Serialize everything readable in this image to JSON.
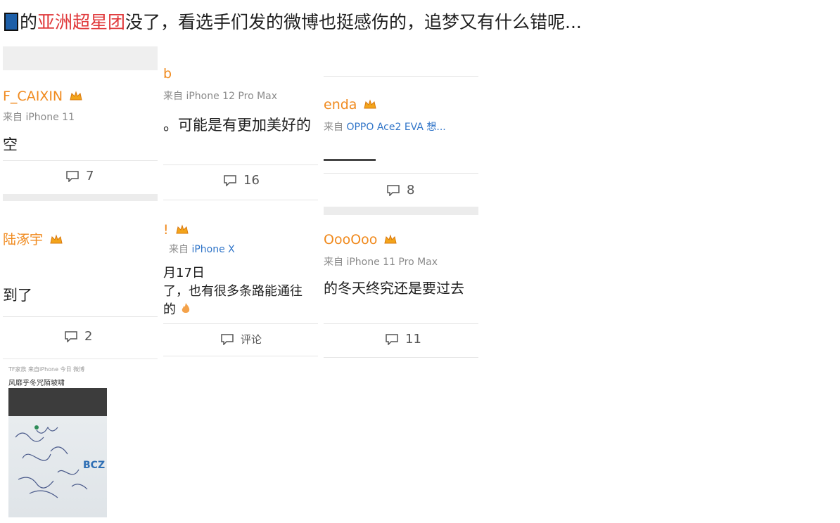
{
  "headline": {
    "mark": "",
    "part1": "的",
    "highlight": "亚洲超星团",
    "part2": "没了，看选手们发的微博也挺感伤的，追梦又有什么错呢..."
  },
  "cards": [
    {
      "user": "F_CAIXIN",
      "source_prefix": "来自 ",
      "source": "iPhone 11",
      "text": "空",
      "comments": "7"
    },
    {
      "user": "b",
      "source_prefix": "来自 ",
      "source": "iPhone 12 Pro Max",
      "text": "。可能是有更加美好的",
      "comments": "16"
    },
    {
      "user": "enda",
      "source_prefix": "来自 ",
      "source": "OPPO Ace2 EVA 想...",
      "text": "",
      "comments": "8"
    },
    {
      "user": "陆涿宇",
      "source_prefix": "",
      "source": "",
      "text": "到了",
      "comments": "2"
    },
    {
      "user": "!",
      "source_prefix": "来自 ",
      "source": "iPhone X",
      "text_line1": "月17日",
      "text_line2": "了，也有很多条路能通往",
      "text_line3": "的",
      "comments": "评论"
    },
    {
      "user": "OooOoo",
      "source_prefix": "来自 ",
      "source": "iPhone 11 Pro Max",
      "text": "的冬天终究还是要过去",
      "comments": "11"
    }
  ],
  "thumbnail": {
    "header": "TF家族 来自iPhone 今日 微博",
    "caption": "风靡乎冬咒陌坡啸",
    "badge": "BCZ"
  },
  "colors": {
    "username": "#f08a1e",
    "highlight": "#e0393b",
    "source_link": "#2f74c8"
  },
  "icons": {
    "comment": "comment-icon",
    "crown": "crown-badge-icon",
    "flame": "flame-emoji-icon"
  }
}
